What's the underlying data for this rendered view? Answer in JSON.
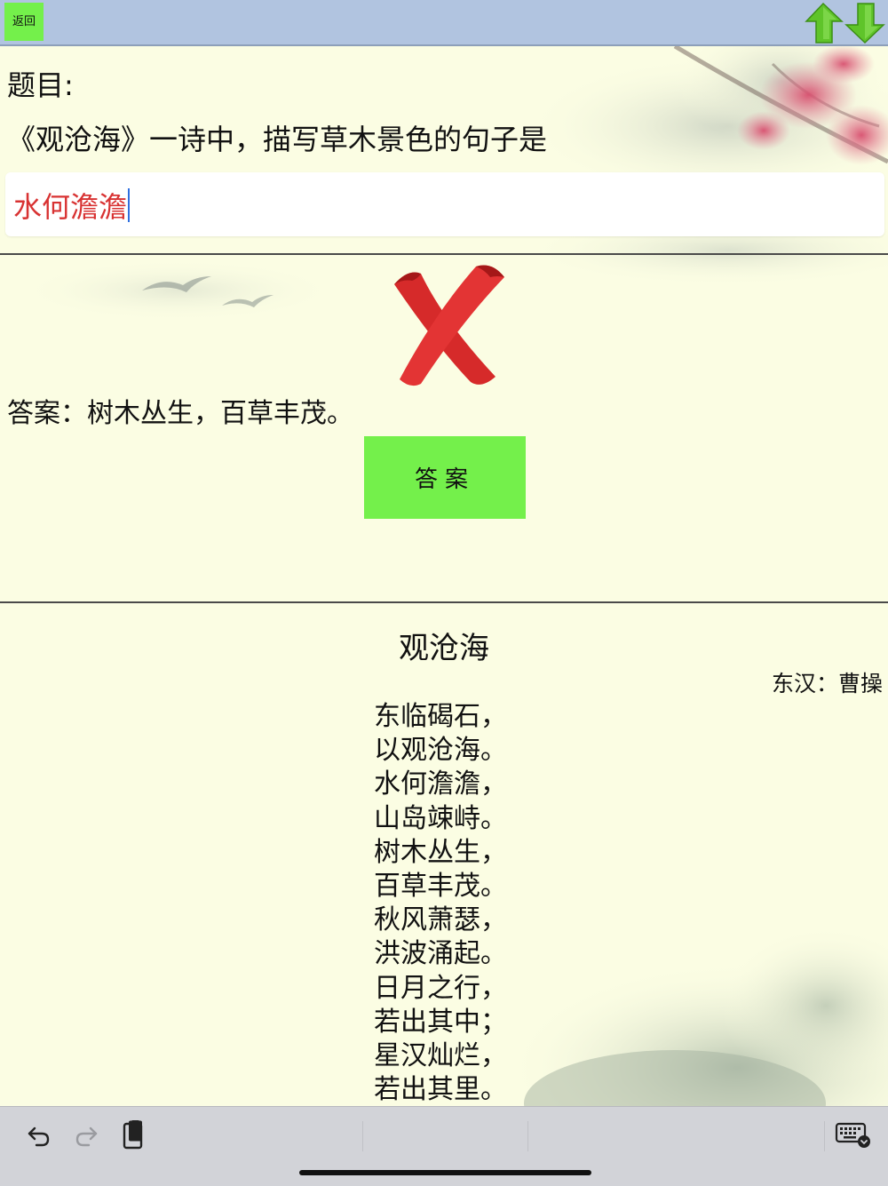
{
  "topbar": {
    "back_label": "返回",
    "prev_icon": "arrow-up-icon",
    "next_icon": "arrow-down-icon"
  },
  "question": {
    "label": "题目:",
    "text": "《观沧海》一诗中，描写草木景色的句子是",
    "user_input": "水何澹澹"
  },
  "result": {
    "status_icon": "wrong-x-icon",
    "answer_text": "答案：树木丛生，百草丰茂。",
    "answer_button_label": "答案"
  },
  "poem": {
    "title": "观沧海",
    "author": "东汉：曹操",
    "lines": [
      "东临碣石，",
      "以观沧海。",
      "水何澹澹，",
      "山岛竦峙。",
      "树木丛生，",
      "百草丰茂。",
      "秋风萧瑟，",
      "洪波涌起。",
      "日月之行，",
      "若出其中；",
      "星汉灿烂，",
      "若出其里。"
    ]
  },
  "keyboard_toolbar": {
    "icons": [
      "undo-icon",
      "redo-icon",
      "paste-icon",
      "keyboard-dismiss-icon"
    ]
  },
  "colors": {
    "topbar": "#b1c4e0",
    "button_green": "#74f04b",
    "page_background": "#fbfde3",
    "input_text": "#d83232",
    "wrong_mark": "#d62a2a",
    "toolbar": "#d2d3d8"
  }
}
